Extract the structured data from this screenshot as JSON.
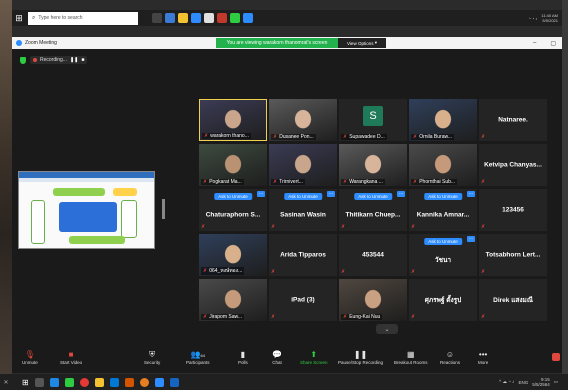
{
  "taskbar_top": {
    "search_placeholder": "Type here to search",
    "time": "11:40 AM",
    "date": "5/5/2021"
  },
  "zoom": {
    "window_title": "Zoom Meeting",
    "share_banner": "You are viewing warakorn thanomrat's screen",
    "view_options": "View Options",
    "recording_label": "Recording...",
    "pause_icon": "pause-icon",
    "stop_icon": "stop-icon"
  },
  "tiles": [
    {
      "name": "warakorn thano...",
      "type": "video",
      "active": true
    },
    {
      "name": "Dusanee Pon...",
      "type": "video"
    },
    {
      "name": "Supawadee D...",
      "type": "avatar",
      "initial": "S"
    },
    {
      "name": "Ornila Buraw...",
      "type": "video"
    },
    {
      "name": "Natnaree.",
      "type": "name"
    },
    {
      "name": "Pogkarat Ma...",
      "type": "video"
    },
    {
      "name": "Trirnivert...",
      "type": "video"
    },
    {
      "name": "Warangkana ...",
      "type": "video"
    },
    {
      "name": "Phornthai Sub...",
      "type": "video"
    },
    {
      "name": "Ketvipa  Chanyas...",
      "type": "name"
    },
    {
      "name": "Chaturaphorn  S...",
      "type": "name",
      "ask": true
    },
    {
      "name": "Sasinan  Wasin",
      "type": "name",
      "ask": true
    },
    {
      "name": "Thitikarn  Chuep...",
      "type": "name",
      "ask": true
    },
    {
      "name": "Kannika  Amnar...",
      "type": "name",
      "ask": true
    },
    {
      "name": "123456",
      "type": "name"
    },
    {
      "name": "064_หงษ์ทอง...",
      "type": "video"
    },
    {
      "name": "Arida  Tipparos",
      "type": "name"
    },
    {
      "name": "453544",
      "type": "name"
    },
    {
      "name": "วัชนา",
      "type": "name",
      "ask": true
    },
    {
      "name": "Totsabhorn  Lert...",
      "type": "name"
    },
    {
      "name": "Jirapom Saw...",
      "type": "video"
    },
    {
      "name": "iPad (3)",
      "type": "name"
    },
    {
      "name": "Eung-Kai Nuu",
      "type": "video"
    },
    {
      "name": "ศุภรพฐ์ ตั้งรูป",
      "type": "name"
    },
    {
      "name": "Direk  แสงมณี",
      "type": "name"
    }
  ],
  "ask_label": "Ask to Unmute",
  "toolbar": {
    "unmute": "Unmute",
    "start_video": "Start Video",
    "security": "Security",
    "participants": "Participants",
    "participants_count": "64",
    "polls": "Polls",
    "chat": "Chat",
    "share_screen": "Share Screen",
    "pause_recording": "Pause/Stop Recording",
    "breakout": "Breakout Rooms",
    "reactions": "Reactions",
    "more": "More"
  },
  "taskbar_bottom": {
    "lang": "ENG",
    "time": "9:15",
    "date": "5/5/2564"
  },
  "colors": {
    "zoom_blue": "#2d8cff",
    "share_green": "#22b14c",
    "mute_red": "#e0483e",
    "active_speaker": "#f1d14b"
  }
}
